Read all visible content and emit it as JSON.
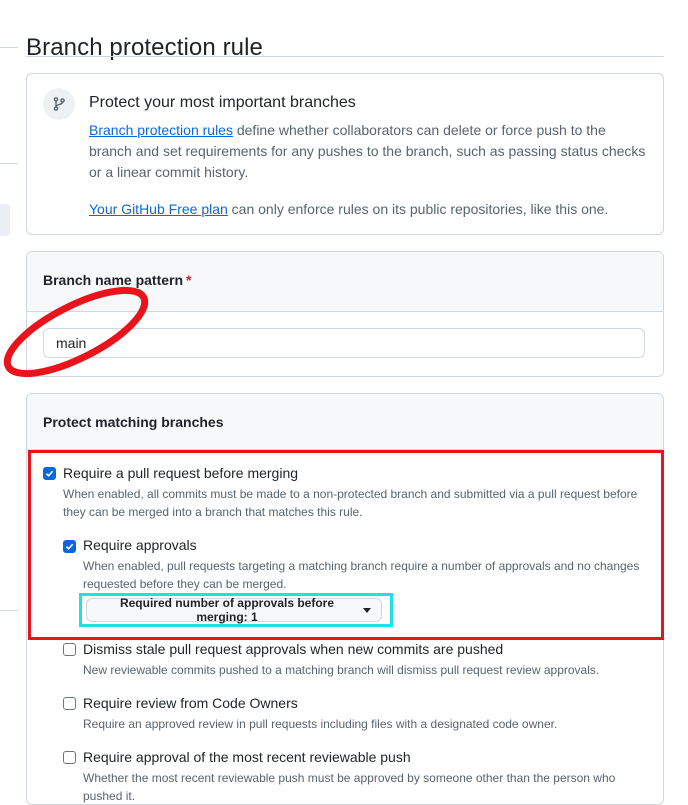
{
  "page": {
    "title": "Branch protection rule"
  },
  "info": {
    "heading": "Protect your most important branches",
    "link1": "Branch protection rules",
    "text1": " define whether collaborators can delete or force push to the branch and set requirements for any pushes to the branch, such as passing status checks or a linear commit history.",
    "link2": "Your GitHub Free plan",
    "text2": " can only enforce rules on its public repositories, like this one.",
    "icon": "git-branch-icon"
  },
  "pattern": {
    "label": "Branch name pattern",
    "required_marker": "*",
    "value": "main"
  },
  "protect": {
    "heading": "Protect matching branches",
    "options": [
      {
        "title": "Require a pull request before merging",
        "desc": "When enabled, all commits must be made to a non-protected branch and submitted via a pull request before they can be merged into a branch that matches this rule.",
        "checked": true
      },
      {
        "title": "Require approvals",
        "desc": "When enabled, pull requests targeting a matching branch require a number of approvals and no changes requested before they can be merged.",
        "checked": true
      },
      {
        "title": "Dismiss stale pull request approvals when new commits are pushed",
        "desc": "New reviewable commits pushed to a matching branch will dismiss pull request review approvals.",
        "checked": false
      },
      {
        "title": "Require review from Code Owners",
        "desc": "Require an approved review in pull requests including files with a designated code owner.",
        "checked": false
      },
      {
        "title": "Require approval of the most recent reviewable push",
        "desc": "Whether the most recent reviewable push must be approved by someone other than the person who pushed it.",
        "checked": false
      }
    ],
    "approvals_button": "Required number of approvals before merging: 1"
  },
  "colors": {
    "accent": "#0969da",
    "annotation_red": "#e8131b",
    "annotation_cyan": "#1de0e8"
  }
}
